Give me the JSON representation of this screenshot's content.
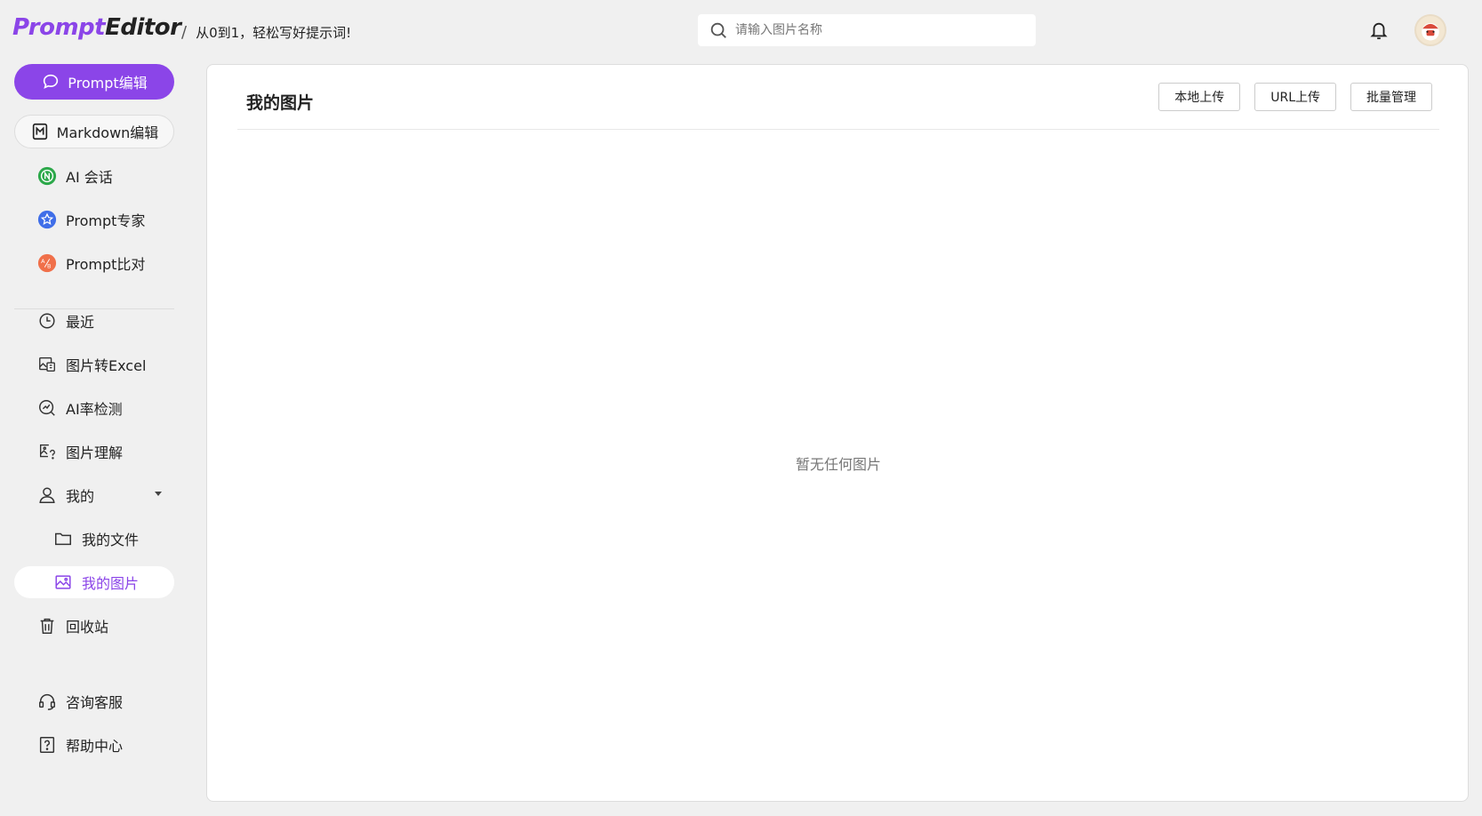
{
  "header": {
    "logo_part1": "Prompt",
    "logo_part2": "Editor",
    "slash": "/",
    "slogan": "从0到1，轻松写好提示词!",
    "search_placeholder": "请输入图片名称"
  },
  "sidebar": {
    "primary_button": "Prompt编辑",
    "outline_button": "Markdown编辑",
    "items": [
      {
        "label": "AI 会话"
      },
      {
        "label": "Prompt专家"
      },
      {
        "label": "Prompt比对"
      },
      {
        "label": "最近"
      },
      {
        "label": "图片转Excel"
      },
      {
        "label": "AI率检测"
      },
      {
        "label": "图片理解"
      },
      {
        "label": "我的"
      },
      {
        "label": "我的文件"
      },
      {
        "label": "我的图片"
      },
      {
        "label": "回收站"
      },
      {
        "label": "咨询客服"
      },
      {
        "label": "帮助中心"
      }
    ]
  },
  "main": {
    "title": "我的图片",
    "buttons": {
      "local_upload": "本地上传",
      "url_upload": "URL上传",
      "batch_manage": "批量管理"
    },
    "empty_text": "暂无任何图片"
  },
  "colors": {
    "accent": "#8b45e8",
    "background": "#f0f0f0"
  }
}
